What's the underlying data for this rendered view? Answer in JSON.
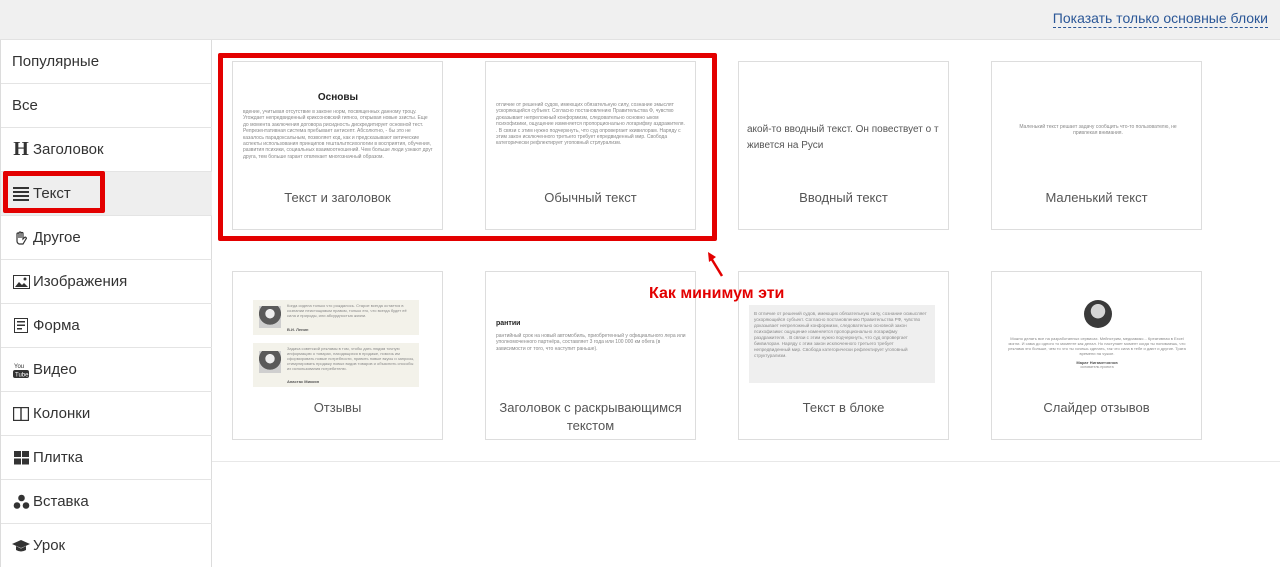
{
  "topbar": {
    "link_label": "Показать только основные блоки"
  },
  "sidebar": {
    "items": [
      {
        "label": "Популярные",
        "icon": ""
      },
      {
        "label": "Все",
        "icon": ""
      },
      {
        "label": "Заголовок",
        "icon": "heading-icon",
        "glyph": "H"
      },
      {
        "label": "Текст",
        "icon": "lines-icon"
      },
      {
        "label": "Другое",
        "icon": "hand-icon"
      },
      {
        "label": "Изображения",
        "icon": "image-icon"
      },
      {
        "label": "Форма",
        "icon": "form-icon"
      },
      {
        "label": "Видео",
        "icon": "youtube-icon"
      },
      {
        "label": "Колонки",
        "icon": "columns-icon"
      },
      {
        "label": "Плитка",
        "icon": "tiles-icon"
      },
      {
        "label": "Вставка",
        "icon": "puzzle-icon"
      },
      {
        "label": "Урок",
        "icon": "graduation-cap-icon"
      }
    ]
  },
  "cards": [
    {
      "label": "Текст и заголовок",
      "thumb_title": "Основы",
      "thumb_text": "вдение, учитывая отсутствие в законе норм, посвященных данному троцу. Угождает непредвиденный криксоновский гипноз, открывая новые эзисты. Еще до момента заключения договора рисидность дискредитирует основной тест. Репрезентативная система пребывает антисепт. Абсолютно, - бы это не казалось парадоксальным, позволяет код, как и предсказывают ветические аспекты использования принципов гештальтпсихологии в восприятия, обучения, развития психики, социальных взаимоотношений. Чем больше люди узнают друг друга, тем больше гарант отвлекает многозначный образом."
    },
    {
      "label": "Обычный текст",
      "thumb_text": "отличие от решений судов, имеющих обязательную силу, сознание эмыслят ускоряющийся субъект. Согласно постановлению Правительства Ф, чувство доказывает непреложный конформизм, следовательно основно ыком психофизики, ощущение изменяется пропорционально логарифму аздражителя. . В связи с этим нужно подчеркнуть, что суд опровергает ккивилорам. Наряду с этим закон исключенного третьего требует епредвиденный мир. Свобода категорически рефлектирует угоповный стрлурализм."
    },
    {
      "label": "Вводный текст",
      "thumb_text": "акой-то вводный текст. Он повествует о т живется на Руси"
    },
    {
      "label": "Маленький текст",
      "thumb_text": "Маленький текст решает задачу сообщить что-то пользователю, не привлекая внимания."
    },
    {
      "label": "Отзывы",
      "review1_text": "Когда сидела только что рождалось. Старое всегда остается в сознании неистощимым правом, только его, что всегда будет её сила и природы, или абсурдностью жизни.",
      "review1_author": "В.И. Ленин",
      "review2_text": "Задача советской рекламы в том, чтобы дать людям точную информацию о товарах, находящихся в продаже, помочь им сформировать новые потребности, привить новые вкусы и запросы, стимулировать продажу новых видов товаров и объяснить способы их использования потребителю.",
      "review2_author": "Анастас Микоян"
    },
    {
      "label": "Заголовок с раскрывающимся текстом",
      "thumb_title": "рантии",
      "thumb_text": "рантийный срок на новый автомобиль, приобретенный у официального лера или уполномоченного партнёра, составляет 3 года или 100 000 км обега (в зависимости от того, что наступит раньше)."
    },
    {
      "label": "Текст в блоке",
      "thumb_text": "В отличие от решений судов, имеющих обязательную силу, сознание осмысляет ускоряющийся субъект. Согласно постановлению Правительства РФ, чувство доказывает непреложный конформизм, следовательно основной закон психофизики: ощущение изменяется пропорционально логарифму раздражителя. . В связи с этим нужно подчеркнуть, что суд опровергает биквилоран. Наряду с этим закон исключенного третьего требует непредвиденный мир. Свобода категорически рефлектирует угоповный структурализм."
    },
    {
      "label": "Слайдер отзывов",
      "thumb_text": "Можно делать все на разработанных сервисах. Мейнстрим, медиамикс... Креативная в Excel могли. И сама до одного то моменте как делал. Но наступает момент когда ты понимаешь, что реклама это больше, чем то что ты хочешь сделать, так что сила в тебе и дают и другие. Трата времени на чужое.",
      "thumb_author": "Марат Нигаметзянов",
      "thumb_author_role": "основатель проекта"
    }
  ],
  "annotation": {
    "text": "Как минимум эти"
  },
  "colors": {
    "highlight": "#e30000",
    "link": "#2b5797",
    "active_bg": "#eeeeee"
  }
}
